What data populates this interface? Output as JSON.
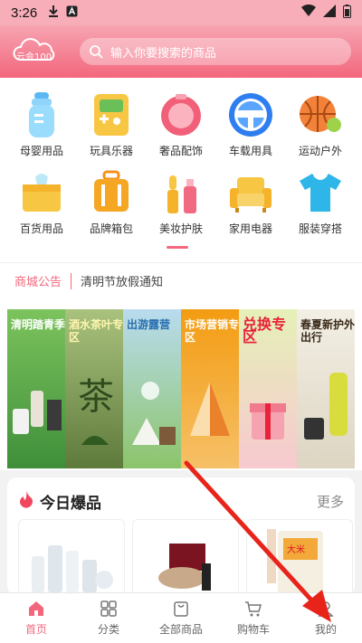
{
  "status": {
    "time": "3:26"
  },
  "header": {
    "logo_text": "云会100",
    "search_placeholder": "输入你要搜索的商品"
  },
  "categories": [
    {
      "label": "母婴用品",
      "icon": "baby-bottle-icon"
    },
    {
      "label": "玩具乐器",
      "icon": "toy-icon"
    },
    {
      "label": "奢品配饰",
      "icon": "luxury-icon"
    },
    {
      "label": "车载用具",
      "icon": "steering-wheel-icon"
    },
    {
      "label": "运动户外",
      "icon": "sports-ball-icon"
    },
    {
      "label": "百货用品",
      "icon": "tissue-box-icon"
    },
    {
      "label": "品牌箱包",
      "icon": "luggage-icon"
    },
    {
      "label": "美妆护肤",
      "icon": "cosmetics-icon"
    },
    {
      "label": "家用电器",
      "icon": "sofa-icon"
    },
    {
      "label": "服装穿搭",
      "icon": "tshirt-icon"
    }
  ],
  "notice": {
    "tag": "商城公告",
    "text": "清明节放假通知"
  },
  "banners": [
    {
      "text": "清明踏青季",
      "color": "#6aa84f"
    },
    {
      "text": "酒水茶叶专区",
      "color": "#7c9a56"
    },
    {
      "text": "出游露营",
      "color": "#8fb8d6"
    },
    {
      "text": "市场营销专区",
      "color": "#f39c12"
    },
    {
      "text": "兑换专区",
      "color": "#f6c2c9"
    },
    {
      "text": "春夏新护外出行",
      "color": "#e9e4d8"
    }
  ],
  "hot": {
    "title": "今日爆品",
    "more": "更多"
  },
  "tabs": [
    {
      "label": "首页",
      "icon": "home-icon",
      "active": true
    },
    {
      "label": "分类",
      "icon": "grid-icon",
      "active": false
    },
    {
      "label": "全部商品",
      "icon": "bag-icon",
      "active": false
    },
    {
      "label": "购物车",
      "icon": "cart-icon",
      "active": false
    },
    {
      "label": "我的",
      "icon": "user-icon",
      "active": false
    }
  ],
  "colors": {
    "accent": "#f3677d",
    "arrow": "#e8231a"
  }
}
